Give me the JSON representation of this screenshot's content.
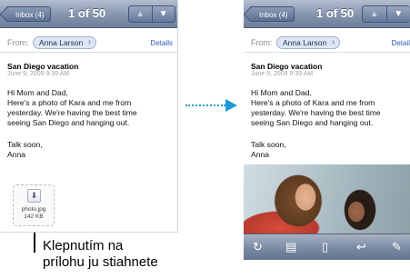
{
  "left_screen": {
    "inbox_label": "Inbox (4)",
    "counter": "1 of 50",
    "from_label": "From:",
    "from_name": "Anna Larson",
    "details_label": "Details",
    "subject": "San Diego vacation",
    "date": "June 9, 2009 9:39 AM",
    "body_lines": [
      "Hi Mom and Dad,",
      "Here's a photo of Kara and me from",
      "yesterday. We're having the best time",
      "seeing San Diego and hanging out."
    ],
    "sign_lines": [
      "Talk soon,",
      "Anna"
    ],
    "attachment": {
      "name": "photo.jpg",
      "size": "142 KB"
    }
  },
  "right_screen": {
    "inbox_label": "Inbox (4)",
    "counter": "1 of 50",
    "from_label": "From:",
    "from_name": "Anna Larson",
    "details_label": "Details",
    "subject": "San Diego vacation",
    "date": "June 9, 2009 9:39 AM",
    "body_lines": [
      "Hi Mom and Dad,",
      "Here's a photo of Kara and me from",
      "yesterday. We're having the best time",
      "seeing San Diego and hanging out."
    ],
    "sign_lines": [
      "Talk soon,",
      "Anna"
    ],
    "toolbar_icons": [
      "refresh-icon",
      "move-folder-icon",
      "trash-icon",
      "reply-icon",
      "compose-icon"
    ]
  },
  "caption": {
    "lines": [
      "Klepnutím na",
      "prílohu ju stiahnete"
    ]
  },
  "colors": {
    "navbar": "#8594ad",
    "link": "#2e5fb6",
    "arrow": "#1b9ad6"
  }
}
